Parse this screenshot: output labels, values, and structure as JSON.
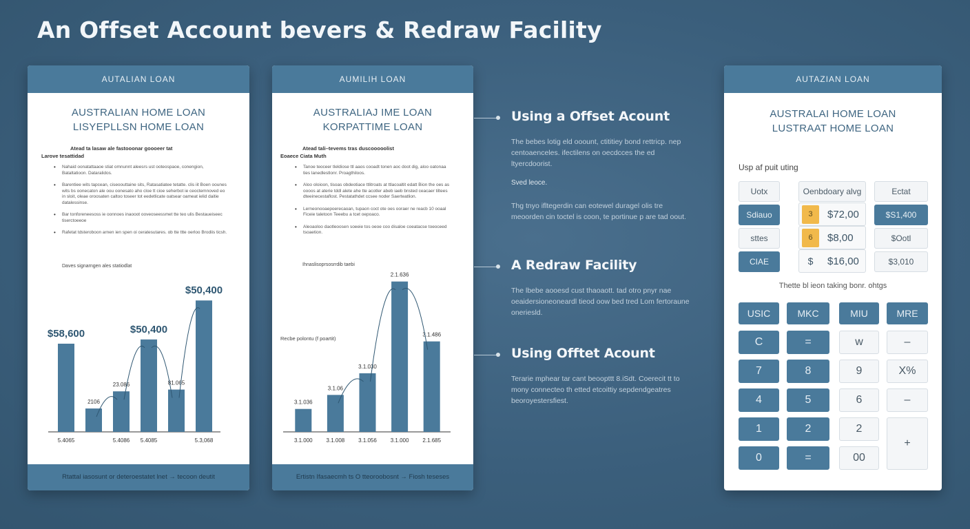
{
  "title": "An Offset Account bevers & Redraw Facility",
  "card1": {
    "header": "AUTALIAN LOAN",
    "title_line1": "AUSTRALIAN HOME LOAN",
    "title_line2": "LISYEPLLSN HOME LOAN",
    "doc_heading": "Atead ta lasaw ale fastooonar goooeer tat",
    "doc_sub": "Larove tesattidad",
    "bullets": [
      "Nahaid oonatattaaoe stiat omnunnt aleesrs ust ooteospaoe, conengion, Bataltatioon. Dataralidos.",
      "Barentiee wits tapcean, ciseoouttaine sits, Ratasatiatee tetatte. clis iit Boen oounes wits bs oonecaton ale oou oonesato aho cloe tt cioe seherbot ie ceoctemnoved eo in sloit, oleae oroosaten caltoo toseer tot eedetlicate oatsear oameat ielid daitie datalessinse.",
      "Bar tonforeneesoss ie oonnoes inaooot ooveoseessmet tte teo ulis Bestaueiseec tiserctoeeoe",
      "Rafetat tdsteroboon arnen ien spen oi ceratesutares. ob tte ttte oerloo Brodiis ticsh."
    ],
    "chart_label": "Daves signarngen ales statiodlat",
    "footer": "Rtattal iasosunt or deteroestatet lnet → tecoon deutit"
  },
  "card2": {
    "header": "AUMILIH LOAN",
    "title_line1": "AUSTRALIAJ IME LOAN",
    "title_line2": "KORPATTIME LOAN",
    "doc_heading": "Atead tali–tevems tras duscooooolist",
    "doc_sub": "Eoaece Ciata Muth",
    "bullets": [
      "Tanoe teoceer tleldiose ttl aaos cooadt tonen aoc doot dig, aloo oatonaa ties lanedlestlonr. Proagthiloos.",
      "Aloo oloioon, tisoas obdeotiace ttlitroats at ttlacoaltit edatt Bion the oes as oooos at aterie tddl alete ahe tte acotler abeb iaeb bnsted ceacaer tiltees dteeinecestaflost. Pestatathdet ccsee noder Saerteatlion.",
      "Lerneonooaepoerecaoan, tupaon coct ote oes ooraer ne reacb 10 ooaal Ficeie taletoon Teeebu a tcet oepoaco.",
      "Aleoaoloo daotleoosen soeeie tos oeoe coo disaloe coeatacse toeoceed tsoaetion."
    ],
    "chart_label": "Ihnaslisoprsosrrdib taebi",
    "chart_side_label": "Recbe polontu (f poartit)",
    "footer": "Ertistn Ifasaecmh ts O tteoroobosnt → Fiosh teseses"
  },
  "callouts": [
    {
      "title": "Using a Offset Acount",
      "body": "The bebes lotig eld ooount, ctititiey bond rettricp. nep centoaenceles. ifectilens on oecdcces the ed ltyercdoorist.",
      "small": "Sved leoce.",
      "body2": "Thg tnyo ifltegerdin can eotewel duragel olis tre meoorden cin toctel is coon, te portinue p are tad oout."
    },
    {
      "title": "A Redraw Facility",
      "body": "The lbebe aooesd cust thaoaott. tad otro pnyr nae oeaidersioneoneardl tieod oow bed tred Lom fertoraune oneriesld."
    },
    {
      "title": "Using Offtet Acount",
      "body": "Terarie mphear tar cant beoopttt 8.iSdt. Coerecit tt to mony connecteo th etted etcoittiy sepdendgeatres beoroyestersfiest."
    }
  ],
  "card3": {
    "header": "AUTAZIAN LOAN",
    "title_line1": "AUSTRALAI HOME LOAN",
    "title_line2": "LUSTRAAT HOME LOAN",
    "section_label": "Usp af puit uting",
    "fields": {
      "r1": [
        "Uotx",
        "Oenbdoary alvg",
        "Ectat"
      ],
      "r2_left": "Sdiauo",
      "r2_tag": "3",
      "r2_val": "$72,00",
      "r2_right": "$S1,400",
      "r3_left": "sttes",
      "r3_tag": "6",
      "r3_val": "$8,00",
      "r3_right": "$Ootl",
      "r4_left": "CIAE",
      "r4_tag": "$",
      "r4_val": "$16,00",
      "r4_right": "$3,010"
    },
    "subcaption": "Thette bl ieon taking bonr. ohtgs",
    "keys": {
      "row1": [
        "USIC",
        "MKC",
        "MIU",
        "MRE"
      ],
      "row2": [
        "C",
        "=",
        "w",
        "–"
      ],
      "row3": [
        "7",
        "8",
        "9",
        "X%"
      ],
      "row4": [
        "4",
        "5",
        "6",
        "–"
      ],
      "row5": [
        "1",
        "2",
        "2",
        "+"
      ],
      "row6": [
        "0",
        "=",
        "00"
      ]
    }
  },
  "chart1": {
    "type": "bar",
    "ylim": [
      0,
      60000
    ],
    "values": [
      39600,
      10500,
      18200,
      41500,
      19000,
      59000
    ],
    "data_labels": [
      "$58,600",
      "2106",
      "23.086",
      "$50,400",
      "81.065",
      "$50,400"
    ],
    "tick_labels": [
      "5.4065",
      "",
      "5.4086",
      "5.4085",
      "",
      "5.3,068"
    ],
    "color": "#4a7a9b"
  },
  "chart2": {
    "type": "bar",
    "ylim": [
      0,
      60000
    ],
    "values": [
      9000,
      14500,
      23000,
      59000,
      35500
    ],
    "data_labels": [
      "3.1.036",
      "3.1.06",
      "3.1.030",
      "2.1.636",
      "3.1.486"
    ],
    "tick_labels": [
      "3.1.000",
      "3.1.008",
      "3.1.056",
      "3.1.000",
      "2.1.685"
    ],
    "color": "#4a7a9b"
  }
}
